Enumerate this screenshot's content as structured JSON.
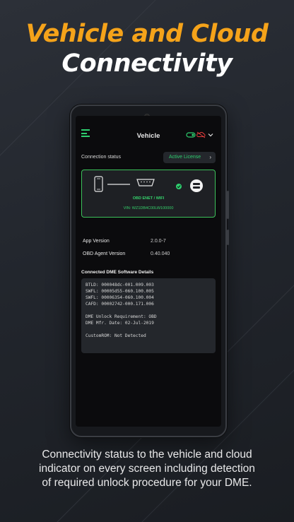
{
  "promo": {
    "title_line1": "Vehicle and Cloud",
    "title_line2": "Connectivity",
    "caption_lines": [
      "Connectivity status to the vehicle and cloud",
      "indicator on every screen including detection",
      "of required unlock procedure for your DME."
    ]
  },
  "appbar": {
    "title": "Vehicle",
    "menu_icon": "hamburger-menu-icon",
    "status_icons": [
      "vehicle-link-icon",
      "cloud-disconnected-icon",
      "chevron-down-icon"
    ]
  },
  "connection": {
    "label": "Connection status",
    "license_button": "Active License",
    "adapter_text": "OBD ENET / WIFI",
    "vin_text": "VIN: WZ1DB4C00LW100000",
    "icons": [
      "phone-icon",
      "obd-port-icon",
      "check-icon",
      "cloud-server-icon"
    ]
  },
  "app_info": [
    {
      "label": "App Version",
      "value": "2.0.0-7"
    },
    {
      "label": "OBD Agent Version",
      "value": "0.40.040"
    }
  ],
  "dme": {
    "title": "Connected DME Software Details",
    "lines": [
      "BTLD: 000048dc-001.009.003",
      "SWFL: 00005d55-060.100.005",
      "SWFL: 00006354-060.100.004",
      "CAFD: 00002742-000.171.006",
      "",
      "DME Unlock Requirement: OBD",
      "DME Mfr. Date: 02-Jul-2019",
      "",
      "CustomROM: Not Detected"
    ]
  },
  "colors": {
    "accent_orange": "#f5a31a",
    "accent_green": "#2ecf6f",
    "alert_red": "#e03a3a"
  }
}
